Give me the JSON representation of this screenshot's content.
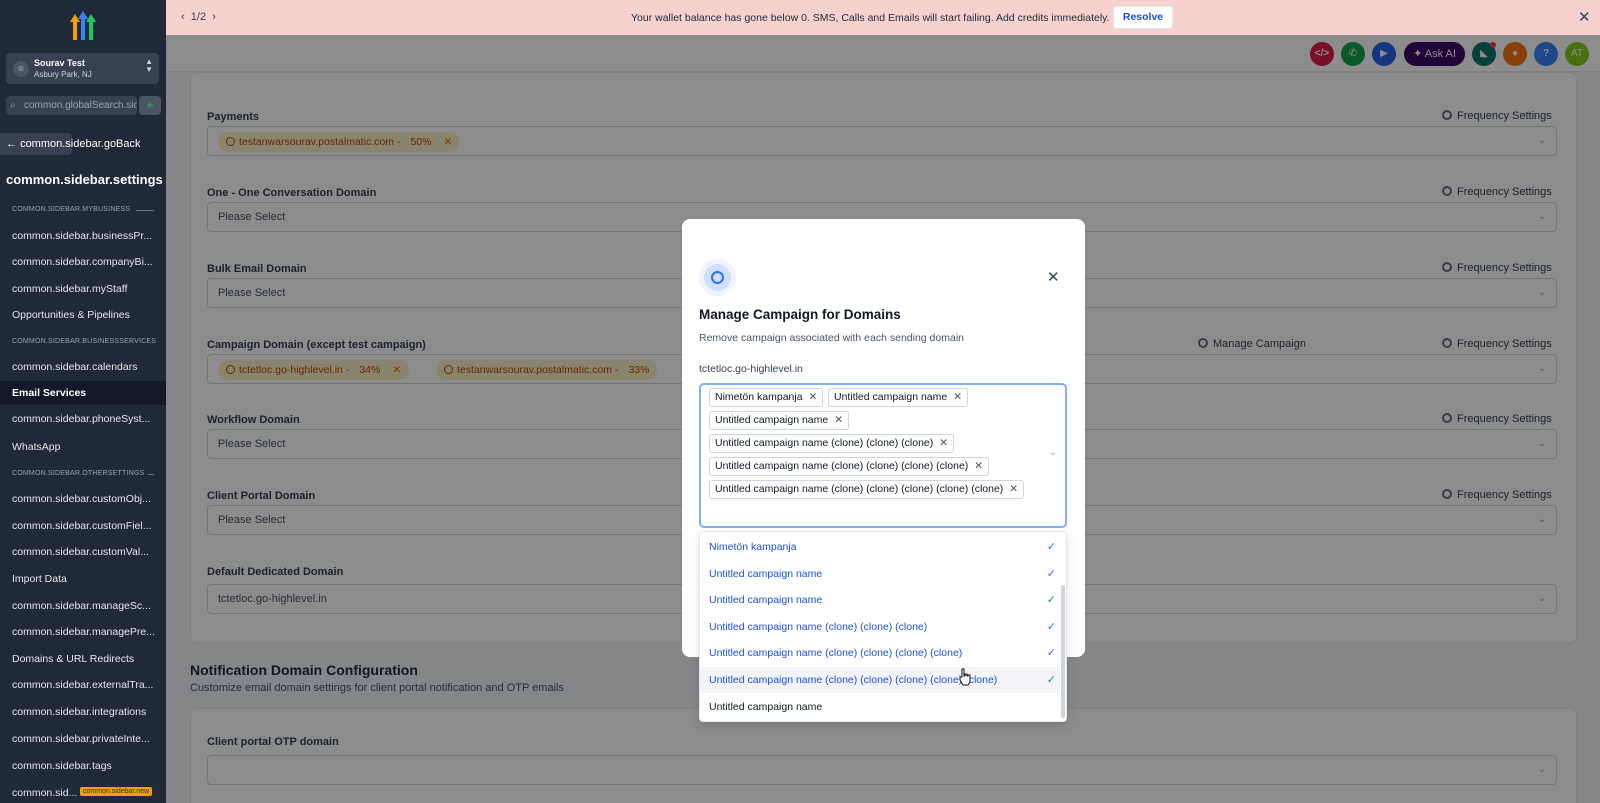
{
  "banner": {
    "pager": "1/2",
    "message": "Your wallet balance has gone below 0. SMS, Calls and Emails will start failing. Add credits immediately.",
    "resolve": "Resolve"
  },
  "sidebar": {
    "location_name": "Sourav Test",
    "location_city": "Asbury Park, NJ",
    "search_placeholder": "common.globalSearch.sidebar",
    "go_back": "common.sidebar.goBack",
    "title": "common.sidebar.settings",
    "sections": {
      "my_business": "COMMON.SIDEBAR.MYBUSINESS",
      "business_services": "COMMON.SIDEBAR.BUSINESSSERVICES",
      "other_settings": "COMMON.SIDEBAR.OTHERSETTINGS"
    },
    "items": [
      "common.sidebar.businessPr...",
      "common.sidebar.companyBi...",
      "common.sidebar.myStaff",
      "Opportunities & Pipelines",
      "common.sidebar.calendars",
      "Email Services",
      "common.sidebar.phoneSyst...",
      "WhatsApp",
      "common.sidebar.customObj...",
      "common.sidebar.customFiel...",
      "common.sidebar.customVal...",
      "Import Data",
      "common.sidebar.manageSc...",
      "common.sidebar.managePre...",
      "Domains & URL Redirects",
      "common.sidebar.externalTra...",
      "common.sidebar.integrations",
      "common.sidebar.privateInte...",
      "common.sidebar.tags",
      "common.sid..."
    ],
    "new_badge": "common.sidebar.new"
  },
  "topbar": {
    "ask_ai": "Ask AI",
    "avatar": "AT",
    "colors": {
      "code": "#e11d48",
      "phone": "#16a34a",
      "video": "#2563eb",
      "megaphone": "#0f766e",
      "bell": "#f97316",
      "help": "#3b82f6",
      "avatar": "#84cc16"
    }
  },
  "form": {
    "frequency_settings": "Frequency Settings",
    "manage_campaign": "Manage Campaign",
    "please_select": "Please Select",
    "fields": {
      "payments": {
        "label": "Payments",
        "tag": "testanwarsourav.postalmatic.com -",
        "pct": "50%"
      },
      "one_one": {
        "label": "One - One Conversation Domain"
      },
      "bulk": {
        "label": "Bulk Email Domain"
      },
      "campaign": {
        "label": "Campaign Domain (except test campaign)",
        "tag1": "tctetloc.go-highlevel.in -",
        "pct1": "34%",
        "tag2": "testanwarsourav.postalmatic.com -",
        "pct2": "33%"
      },
      "workflow": {
        "label": "Workflow Domain"
      },
      "client_portal": {
        "label": "Client Portal Domain"
      },
      "default_dedicated": {
        "label": "Default Dedicated Domain",
        "value": "tctetloc.go-highlevel.in"
      }
    },
    "notification": {
      "title": "Notification Domain Configuration",
      "subtitle": "Customize email domain settings for client portal notification and OTP emails",
      "otp_label": "Client portal OTP domain"
    }
  },
  "modal": {
    "title": "Manage Campaign for Domains",
    "subtitle": "Remove campaign associated with each sending domain",
    "domain": "tctetloc.go-highlevel.in",
    "chips": [
      "Nimetön kampanja",
      "Untitled campaign name",
      "Untitled campaign name",
      "Untitled campaign name (clone) (clone) (clone)",
      "Untitled campaign name (clone) (clone) (clone) (clone)",
      "Untitled campaign name (clone) (clone) (clone) (clone) (clone)"
    ],
    "options": [
      "Nimetön kampanja",
      "Untitled campaign name",
      "Untitled campaign name",
      "Untitled campaign name (clone) (clone) (clone)",
      "Untitled campaign name (clone) (clone) (clone) (clone)",
      "Untitled campaign name (clone) (clone) (clone) (clone) (clone)",
      "Untitled campaign name"
    ]
  }
}
